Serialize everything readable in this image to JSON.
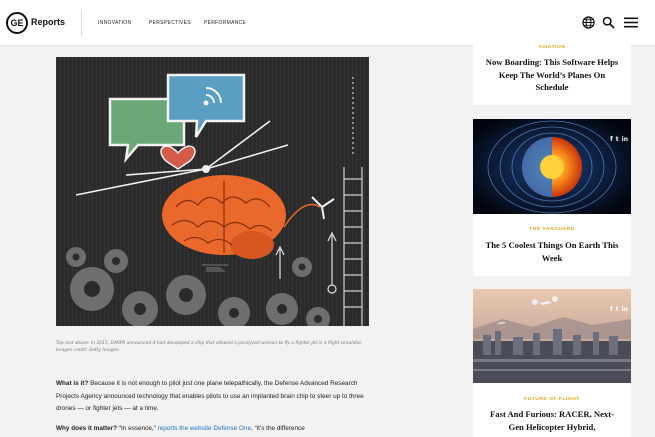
{
  "header": {
    "logo_text": "GE",
    "brand": "Reports",
    "nav": [
      "INNOVATION",
      "PERSPECTIVES",
      "PERFORMANCE"
    ],
    "icons": [
      "globe-icon",
      "search-icon",
      "menu-icon"
    ]
  },
  "article": {
    "caption": "Top and above: In 2015, DARPA announced it had developed a chip that allowed a paralyzed woman to fly a fighter jet in a flight simulator. Images credit: Getty Images.",
    "para1_lead": "What is it?",
    "para1_text": " Because it is not enough to pilot just one plane telepathically, the Defense Advanced Research Projects Agency announced technology that enables pilots to use an implanted brain chip to steer up to three drones — or fighter jets — at a time.",
    "para2_lead": "Why does it matter?",
    "para2_text_a": " “In essence,” ",
    "para2_link": "reports the website Defense One",
    "para2_text_b": ", “it’s the difference"
  },
  "sidebar": {
    "cards": [
      {
        "kicker": "AVIATION",
        "title": "Now Boarding: This Software Helps Keep The World’s Planes On Schedule"
      },
      {
        "kicker": "THE VANGUARD",
        "title": "The 5 Coolest Things On Earth This Week",
        "share": [
          "f",
          "t",
          "in"
        ]
      },
      {
        "kicker": "FUTURE OF FLIGHT",
        "title": "Fast And Furious: RACER, Next-Gen Helicopter Hybrid,",
        "share": [
          "f",
          "t",
          "in"
        ]
      }
    ]
  },
  "colors": {
    "kicker": "#e2a21b",
    "link": "#1f73c4",
    "hero_bg": "#2b2b2b",
    "brain": "#e8692b"
  }
}
